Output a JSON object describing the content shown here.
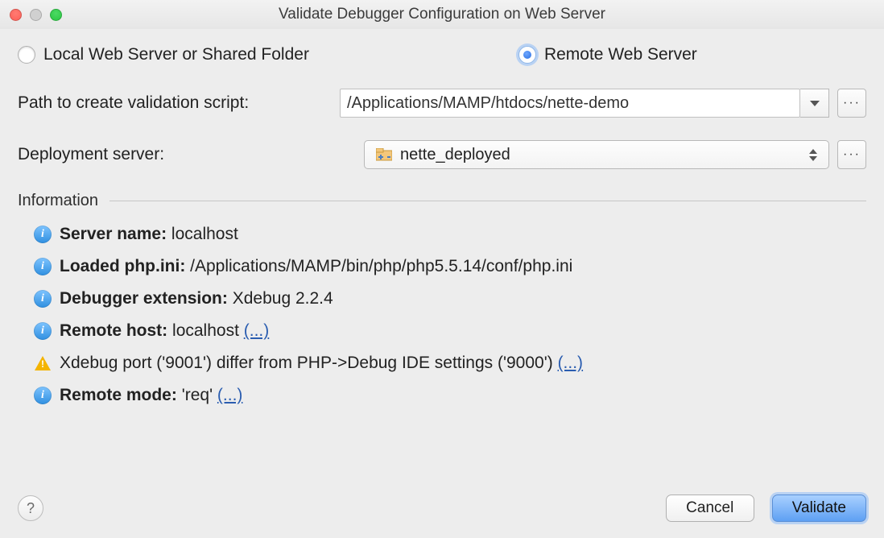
{
  "window": {
    "title": "Validate Debugger Configuration on Web Server"
  },
  "options": {
    "local_label": "Local Web Server or Shared Folder",
    "remote_label": "Remote Web Server",
    "selected": "remote"
  },
  "path_row": {
    "label": "Path to create validation script:",
    "value": "/Applications/MAMP/htdocs/nette-demo"
  },
  "deploy_row": {
    "label": "Deployment server:",
    "value": "nette_deployed"
  },
  "information": {
    "header": "Information",
    "items": [
      {
        "icon": "info",
        "key": "Server name:",
        "value": "localhost",
        "link": ""
      },
      {
        "icon": "info",
        "key": "Loaded php.ini:",
        "value": "/Applications/MAMP/bin/php/php5.5.14/conf/php.ini",
        "link": ""
      },
      {
        "icon": "info",
        "key": "Debugger extension:",
        "value": "Xdebug 2.2.4",
        "link": ""
      },
      {
        "icon": "info",
        "key": "Remote host:",
        "value": "localhost",
        "link": "(...)"
      },
      {
        "icon": "warn",
        "key": "",
        "value": "Xdebug port ('9001') differ from PHP->Debug IDE settings ('9000')",
        "link": "(...)"
      },
      {
        "icon": "info",
        "key": "Remote mode:",
        "value": "'req'",
        "link": "(...)"
      }
    ]
  },
  "buttons": {
    "help": "?",
    "cancel": "Cancel",
    "validate": "Validate"
  }
}
